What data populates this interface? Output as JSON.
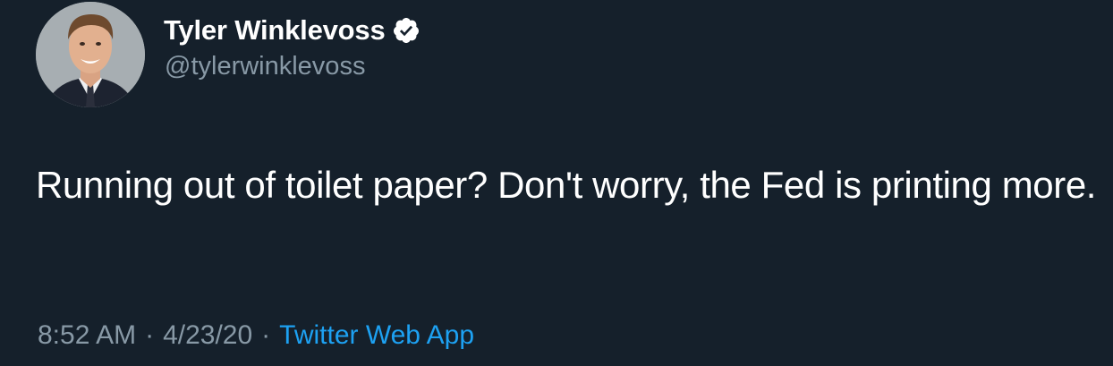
{
  "author": {
    "display_name": "Tyler Winklevoss",
    "handle": "@tylerwinklevoss",
    "verified": true,
    "avatar_icon": "profile-photo"
  },
  "tweet": {
    "text": "Running out of toilet paper? Don't worry, the Fed is printing more.",
    "time": "8:52 AM",
    "date": "4/23/20",
    "separator": "·",
    "source": "Twitter Web App"
  },
  "colors": {
    "background": "#15202b",
    "text": "#ffffff",
    "secondary_text": "#8899a6",
    "link": "#1da1f2"
  }
}
